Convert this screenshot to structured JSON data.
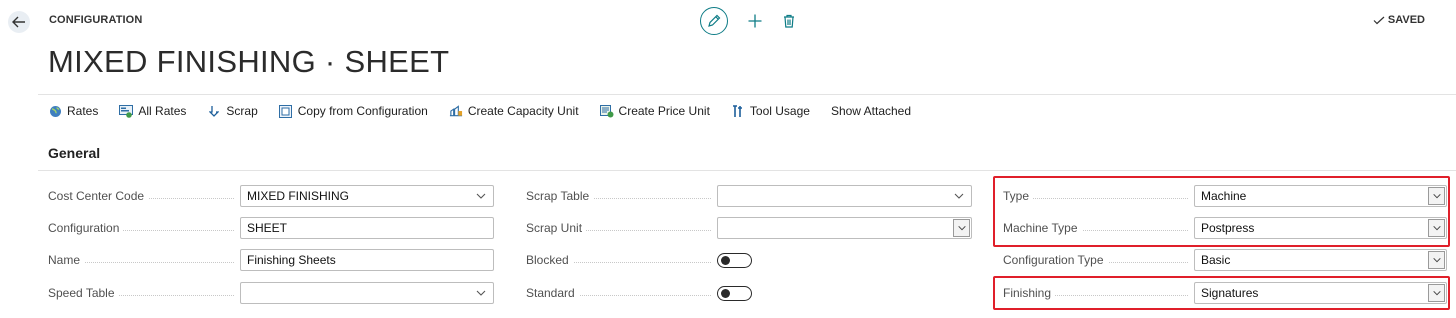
{
  "header": {
    "breadcrumb": "CONFIGURATION",
    "saved_label": "SAVED",
    "title": "MIXED FINISHING · SHEET"
  },
  "actions": [
    {
      "label": "Rates",
      "icon": "globe-icon"
    },
    {
      "label": "All Rates",
      "icon": "all-rates-icon"
    },
    {
      "label": "Scrap",
      "icon": "arrow-down-icon"
    },
    {
      "label": "Copy from Configuration",
      "icon": "copy-icon"
    },
    {
      "label": "Create Capacity Unit",
      "icon": "capacity-unit-icon"
    },
    {
      "label": "Create Price Unit",
      "icon": "price-unit-icon"
    },
    {
      "label": "Tool Usage",
      "icon": "tool-usage-icon"
    },
    {
      "label": "Show Attached",
      "icon": ""
    }
  ],
  "section": {
    "title": "General"
  },
  "fields": {
    "cost_center_code": {
      "label": "Cost Center Code",
      "value": "MIXED FINISHING"
    },
    "configuration": {
      "label": "Configuration",
      "value": "SHEET"
    },
    "name": {
      "label": "Name",
      "value": "Finishing Sheets"
    },
    "speed_table": {
      "label": "Speed Table",
      "value": ""
    },
    "scrap_table": {
      "label": "Scrap Table",
      "value": ""
    },
    "scrap_unit": {
      "label": "Scrap Unit",
      "value": ""
    },
    "blocked": {
      "label": "Blocked",
      "value": false
    },
    "standard": {
      "label": "Standard",
      "value": false
    },
    "type": {
      "label": "Type",
      "value": "Machine"
    },
    "machine_type": {
      "label": "Machine Type",
      "value": "Postpress"
    },
    "configuration_type": {
      "label": "Configuration Type",
      "value": "Basic"
    },
    "finishing": {
      "label": "Finishing",
      "value": "Signatures"
    }
  },
  "colors": {
    "accent": "#0e7c86",
    "highlight": "#e01f2a"
  }
}
